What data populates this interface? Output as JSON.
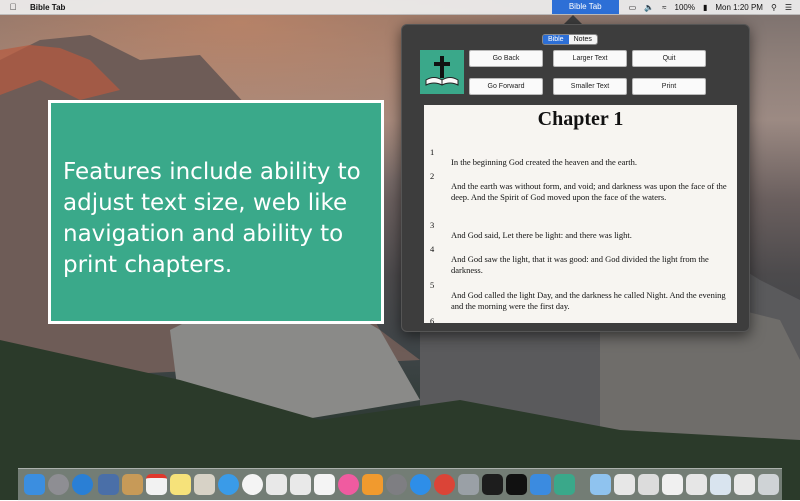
{
  "menubar": {
    "app_name": "Bible Tab",
    "status_item": "Bible Tab",
    "battery": "100%",
    "clock": "Mon 1:20 PM"
  },
  "popover": {
    "tabs": [
      "Bible",
      "Notes"
    ],
    "active_tab": "Bible",
    "buttons": {
      "go_back": "Go Back",
      "go_forward": "Go Forward",
      "larger_text": "Larger Text",
      "smaller_text": "Smaller Text",
      "quit": "Quit",
      "print": "Print"
    },
    "chapter_title": "Chapter 1",
    "verses": [
      {
        "num": "1",
        "text": "In the beginning God created the heaven and the earth."
      },
      {
        "num": "2",
        "text": "And the earth was without form, and void; and darkness was upon the face of the deep. And the Spirit of God moved upon the face of the waters."
      },
      {
        "num": "3",
        "text": "And God said, Let there be light: and there was light."
      },
      {
        "num": "4",
        "text": "And God saw the light, that it was good: and God divided the light from the darkness."
      },
      {
        "num": "5",
        "text": "And God called the light Day, and the darkness he called Night. And the evening and the morning were the first day."
      },
      {
        "num": "6",
        "text": ""
      }
    ]
  },
  "callout": {
    "text": "Features include ability to adjust text size, web like navigation and ability to print chapters."
  },
  "colors": {
    "accent_teal": "#3aa98a",
    "selection_blue": "#2d6fd6"
  },
  "dock": {
    "icons": [
      "finder-icon",
      "launchpad-icon",
      "safari-icon",
      "contacts-icon",
      "calendar-icon",
      "notes-icon",
      "preview-icon",
      "messages-icon",
      "photos-icon",
      "keynote-icon",
      "numbers-icon",
      "itunes-icon",
      "ibooks-icon",
      "system-preferences-icon",
      "app-store-icon",
      "chrome-icon",
      "utility-icon",
      "activity-monitor-icon",
      "terminal-icon",
      "xcode-icon",
      "bible-tab-icon",
      "folder-icon",
      "documents-icon",
      "trash-icon"
    ]
  }
}
